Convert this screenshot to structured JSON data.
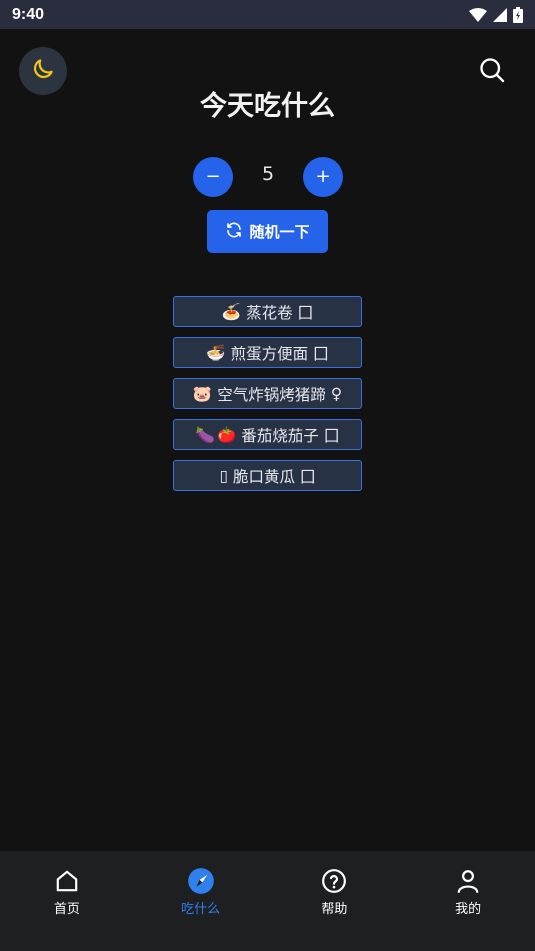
{
  "status_bar": {
    "time": "9:40"
  },
  "header": {
    "title": "今天吃什么"
  },
  "stepper": {
    "minus": "−",
    "value": "5",
    "plus": "+"
  },
  "random_button": {
    "label": "随机一下"
  },
  "dishes": [
    {
      "emoji": [
        "🍝"
      ],
      "name": "蒸花卷",
      "suffix": "⼞"
    },
    {
      "emoji": [
        "🍜"
      ],
      "name": "煎蛋方便面",
      "suffix": "⼞"
    },
    {
      "emoji": [
        "🐷"
      ],
      "name": "空气炸锅烤猪蹄",
      "suffix": "♀"
    },
    {
      "emoji": [
        "🍆",
        "🍅"
      ],
      "name": "番茄烧茄子",
      "suffix": "⼞"
    },
    {
      "emoji": [
        "▯"
      ],
      "name": "脆口黄瓜",
      "suffix": "⼞"
    }
  ],
  "tabs": [
    {
      "label": "首页",
      "icon": "home-icon",
      "active": false
    },
    {
      "label": "吃什么",
      "icon": "compass-icon",
      "active": true
    },
    {
      "label": "帮助",
      "icon": "help-icon",
      "active": false
    },
    {
      "label": "我的",
      "icon": "user-icon",
      "active": false
    }
  ],
  "colors": {
    "accent": "#2563eb",
    "moon": "#f5c518",
    "tab_active": "#2f80ed"
  }
}
